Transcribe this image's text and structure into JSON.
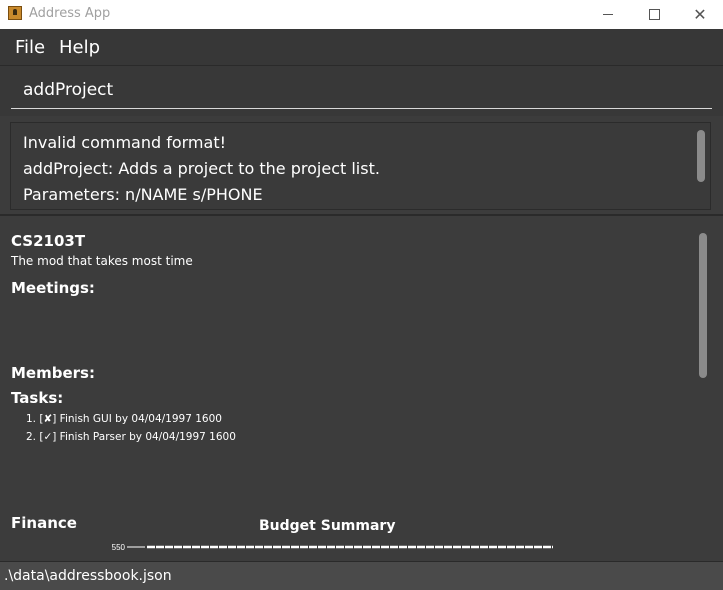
{
  "window": {
    "title": "Address App",
    "icon": "address-book-icon"
  },
  "menu": {
    "items": [
      "File",
      "Help"
    ]
  },
  "command": {
    "value": "addProject"
  },
  "result": {
    "lines": [
      "Invalid command format!",
      "addProject: Adds a project to the project list.",
      "Parameters: n/NAME s/PHONE"
    ]
  },
  "project": {
    "name": "CS2103T",
    "description": "The mod that takes most time",
    "meetings_label": "Meetings:",
    "members_label": "Members:",
    "tasks_label": "Tasks:",
    "tasks": [
      "1. [✘] Finish GUI by 04/04/1997 1600",
      "2. [✓] Finish Parser by 04/04/1997 1600"
    ],
    "finance_label": "Finance"
  },
  "chart_data": {
    "type": "line",
    "title": "Budget Summary",
    "ytick_visible": "550",
    "series_color": "#ffffff"
  },
  "status": {
    "path": ".\\data\\addressbook.json"
  },
  "colors": {
    "background": "#3c3c3c",
    "titlebar": "#ffffff",
    "text": "#ffffff",
    "statusbar": "#4a4a4a"
  }
}
